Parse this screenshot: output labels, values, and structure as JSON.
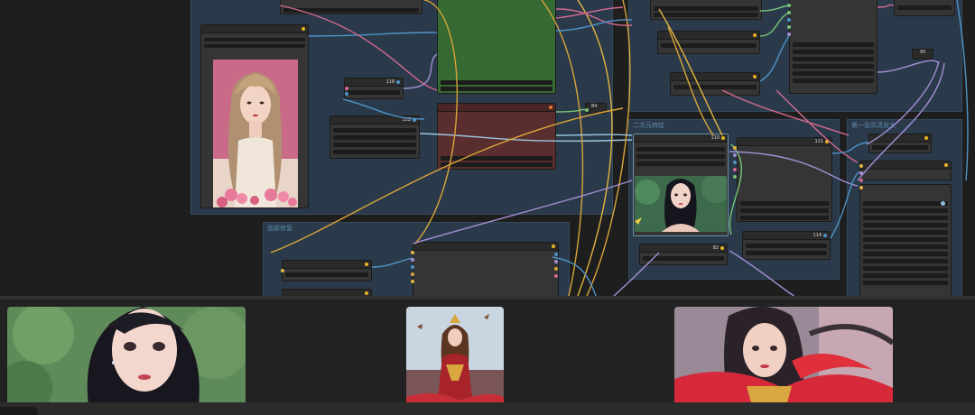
{
  "groups": [
    {
      "id": "g-main",
      "title": ""
    },
    {
      "id": "g-lower",
      "title": "面部修复"
    },
    {
      "id": "g-upper-right",
      "title": ""
    },
    {
      "id": "g-mid-right",
      "title": "二次元转绘"
    },
    {
      "id": "g-far-right",
      "title": "第一张高清放大"
    }
  ],
  "nodes": [
    {
      "id": "n-top-left",
      "num": "",
      "ports": "yellow"
    },
    {
      "id": "n-load-image",
      "num": "",
      "ports": "yellow"
    },
    {
      "id": "n-small-mid",
      "num": "118",
      "ports": "blue"
    },
    {
      "id": "n-mid-left",
      "num": "112",
      "ports": "blue"
    },
    {
      "id": "n-green",
      "num": ""
    },
    {
      "id": "n-red",
      "num": "",
      "ports": "orange"
    },
    {
      "id": "n-84",
      "num": "84",
      "ports": "yellow"
    },
    {
      "id": "n-upper-right-a",
      "num": "",
      "ports": "yellow"
    },
    {
      "id": "n-upper-right-b",
      "num": "",
      "ports": "yellow"
    },
    {
      "id": "n-upper-right-c",
      "num": "",
      "ports": "yellow"
    },
    {
      "id": "n-upper-right-list",
      "num": "",
      "ports": "green"
    },
    {
      "id": "n-top-far-right",
      "num": "",
      "ports": "blue"
    },
    {
      "id": "n-95",
      "num": "95",
      "ports": "yellow"
    },
    {
      "id": "n-preview",
      "num": "110",
      "ports": "yellow"
    },
    {
      "id": "n-mid-right-list",
      "num": "111",
      "ports": "yellow"
    },
    {
      "id": "n-82",
      "num": "82",
      "ports": "yellow"
    },
    {
      "id": "n-114",
      "num": "114",
      "ports": "blue"
    },
    {
      "id": "n-far-a",
      "num": "",
      "ports": "yellow"
    },
    {
      "id": "n-far-b",
      "num": "",
      "ports": "yellow"
    },
    {
      "id": "n-far-list",
      "num": "",
      "ports": "blue"
    },
    {
      "id": "n-lower-a",
      "num": "",
      "ports": "yellow"
    },
    {
      "id": "n-lower-b",
      "num": "",
      "ports": "yellow"
    },
    {
      "id": "n-lower-big",
      "num": "",
      "ports": "yellow"
    }
  ],
  "gallery": [
    {
      "id": "thumb-1",
      "subject": "close-up portrait, dark hair, green foliage background"
    },
    {
      "id": "thumb-2",
      "subject": "warrior girl in red dress, birds in sky"
    },
    {
      "id": "thumb-3",
      "subject": "girl with red ribbons and golden armor"
    }
  ],
  "colors": {
    "canvas": "#1e1e1e",
    "group": "#2a3a4a",
    "node": "#353535",
    "green_node": "#356a33",
    "red_node": "#5a2e2e",
    "wire_yellow": "#d9a53a",
    "wire_blue": "#4f94c8",
    "wire_purple": "#a58fd6",
    "wire_pink": "#d36a8e",
    "wire_green": "#7bc57a"
  }
}
